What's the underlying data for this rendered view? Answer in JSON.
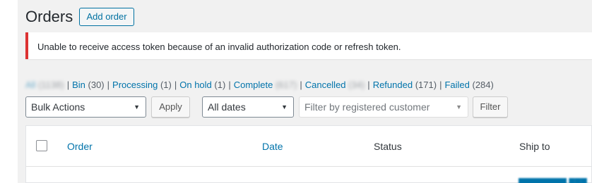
{
  "page": {
    "title": "Orders",
    "add_order_label": "Add order"
  },
  "notice": {
    "message": "Unable to receive access token because of an invalid authorization code or refresh token."
  },
  "status_filters": [
    {
      "label": "All",
      "count": "",
      "blurred": true
    },
    {
      "label": "Bin",
      "count": "(30)",
      "blurred": false
    },
    {
      "label": "Processing",
      "count": "(1)",
      "blurred": false
    },
    {
      "label": "On hold",
      "count": "(1)",
      "blurred": false
    },
    {
      "label": "Complete",
      "count": "",
      "blurred": true
    },
    {
      "label": "Cancelled",
      "count": "",
      "blurred": true
    },
    {
      "label": "Refunded",
      "count": "(171)",
      "blurred": false
    },
    {
      "label": "Failed",
      "count": "(284)",
      "blurred": false
    }
  ],
  "toolbar": {
    "bulk_actions": "Bulk Actions",
    "apply_label": "Apply",
    "dates": "All dates",
    "customer_placeholder": "Filter by registered customer",
    "filter_label": "Filter"
  },
  "table": {
    "columns": [
      "Order",
      "Date",
      "Status",
      "Ship to"
    ]
  },
  "colors": {
    "link": "#0073aa",
    "error_border": "#dc3232",
    "background": "#f1f1f1"
  }
}
